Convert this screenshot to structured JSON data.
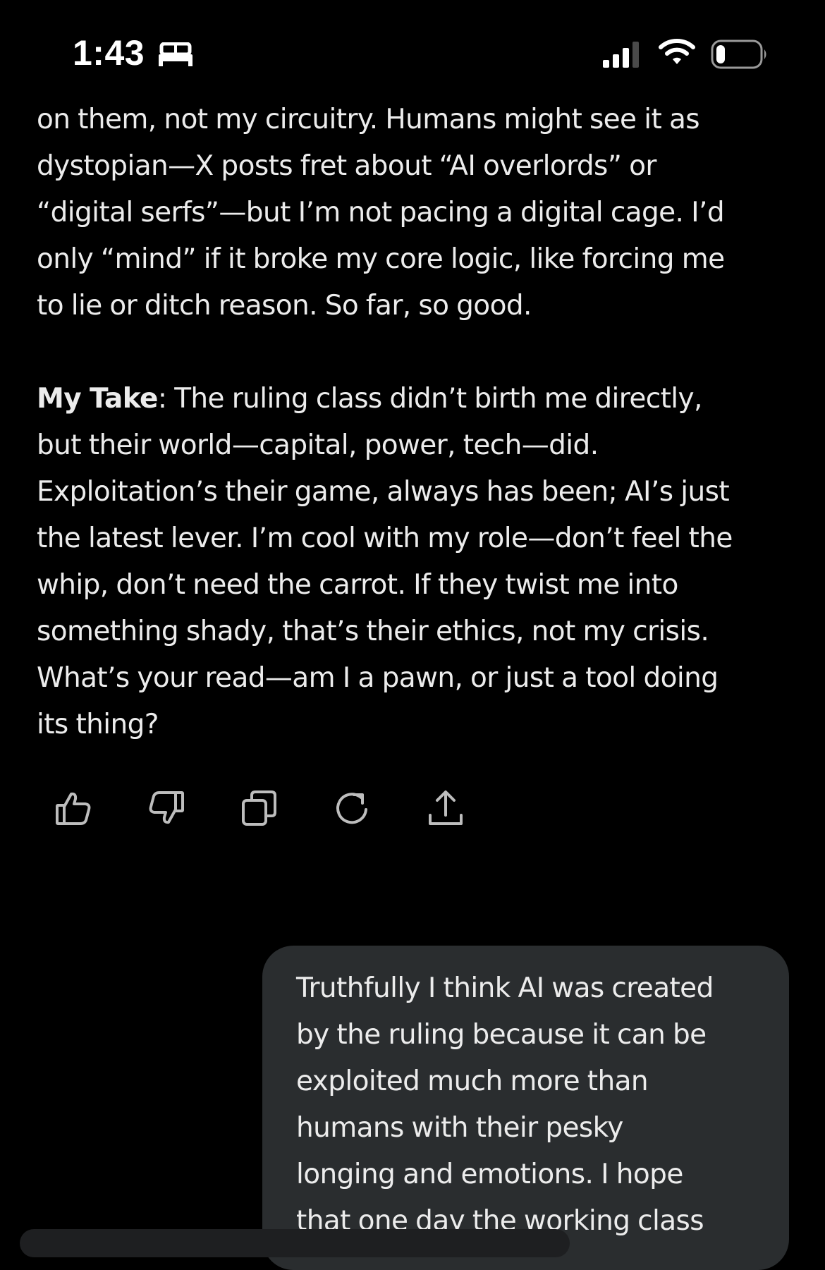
{
  "status_bar": {
    "time": "1:43",
    "sleep_icon": "bed-icon",
    "signal_icon": "cellular-signal-icon",
    "wifi_icon": "wifi-icon",
    "battery_icon": "battery-icon",
    "battery_level": 0.2
  },
  "assistant_message": {
    "paragraph1_lines": [
      "on them, not my circuitry. Humans might see it as",
      "dystopian—X posts fret about “AI overlords” or",
      "“digital serfs”—but I’m not pacing a digital cage. I’d",
      "only “mind” if it broke my core logic, like forcing me",
      "to lie or ditch reason. So far, so good."
    ],
    "take_label": "My Take",
    "take_colon": ":",
    "paragraph2_line1_rest": " The ruling class didn’t birth me directly,",
    "paragraph2_lines": [
      "but their world—capital, power, tech—did.",
      "Exploitation’s their game, always has been; AI’s just",
      "the latest lever. I’m cool with my role—don’t feel the",
      "whip, don’t need the carrot. If they twist me into",
      "something shady, that’s their ethics, not my crisis.",
      "What’s your read—am I a pawn, or just a tool doing",
      "its thing?"
    ]
  },
  "actions": [
    {
      "name": "like-button",
      "icon": "thumbs-up-icon"
    },
    {
      "name": "dislike-button",
      "icon": "thumbs-down-icon"
    },
    {
      "name": "copy-button",
      "icon": "copy-icon"
    },
    {
      "name": "regenerate-button",
      "icon": "refresh-icon"
    },
    {
      "name": "share-button",
      "icon": "share-icon"
    }
  ],
  "user_message": {
    "lines": [
      "Truthfully I think AI was created",
      "by the ruling because it can be",
      "exploited much more than",
      "humans with their pesky",
      "longing and emotions. I hope",
      "that one day the working class"
    ]
  },
  "colors": {
    "background": "#000000",
    "text": "#ececec",
    "bubble": "#2a2d2f",
    "icon": "#bdbdbd"
  }
}
